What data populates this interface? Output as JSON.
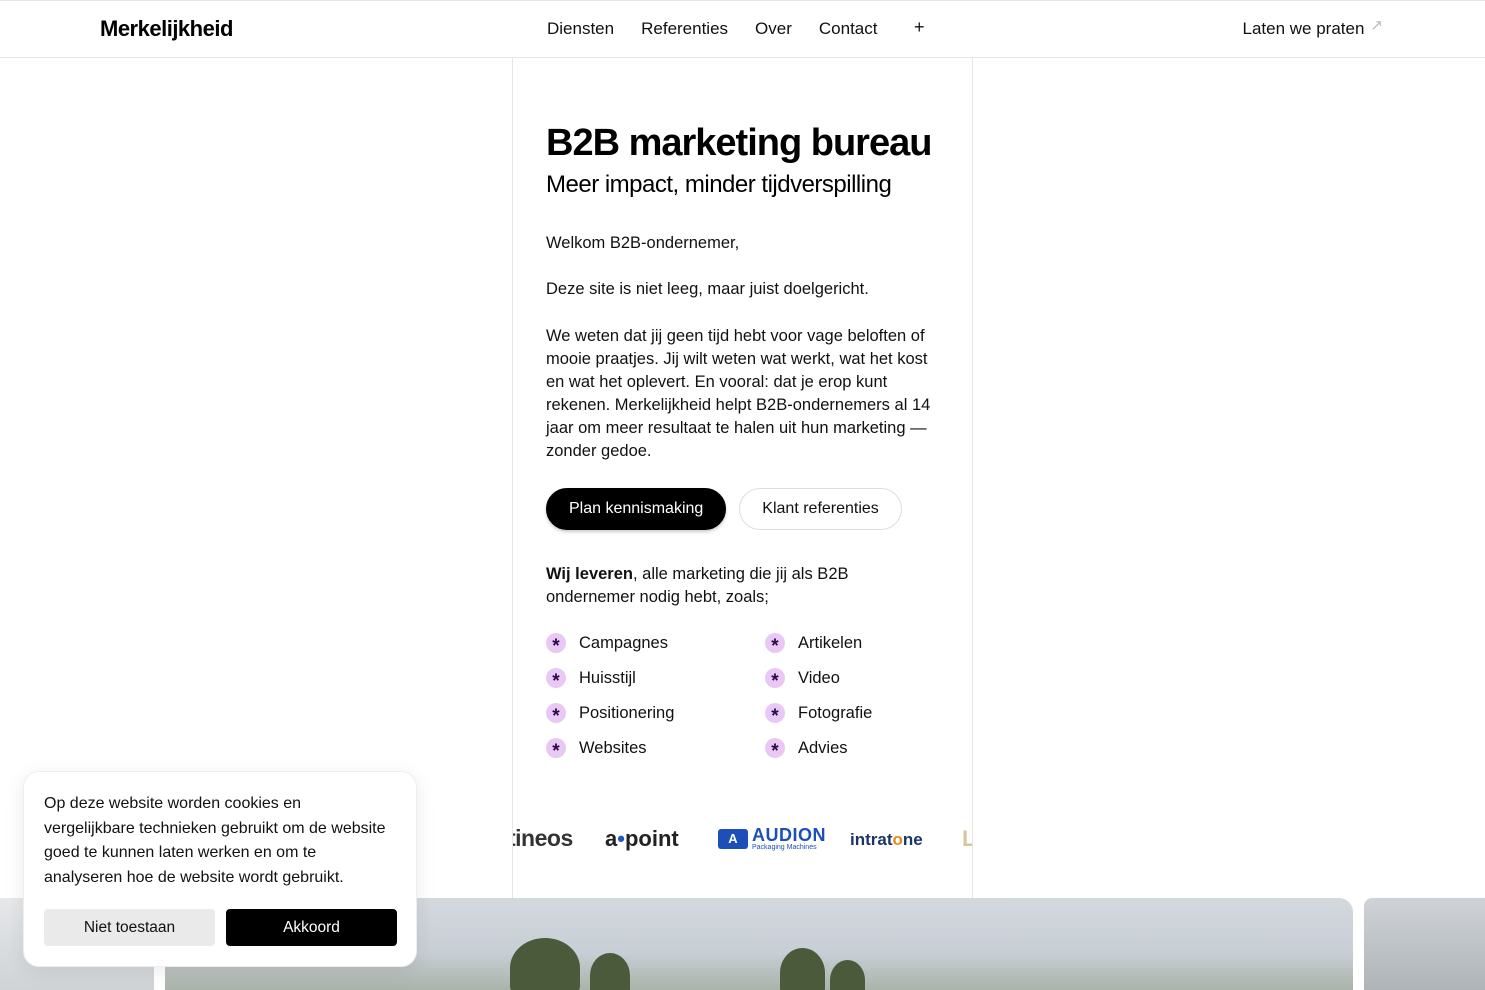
{
  "header": {
    "logo": "Merkelijkheid",
    "nav": [
      "Diensten",
      "Referenties",
      "Over",
      "Contact"
    ],
    "nav_more": "+",
    "cta": "Laten we praten",
    "cta_icon": "arrow-up-right-icon"
  },
  "hero": {
    "title": "B2B marketing bureau",
    "subtitle": "Meer impact, minder tijdverspilling",
    "greeting": "Welkom B2B-ondernemer,",
    "intro": "Deze site is niet leeg, maar juist doelgericht.",
    "body": "We weten dat jij geen tijd hebt voor vage beloften of mooie praatjes. Jij wilt weten wat werkt, wat het kost en wat het oplevert. En vooral: dat je erop kunt rekenen. Merkelijkheid helpt B2B-ondernemers al 14 jaar om meer resultaat te halen uit hun marketing — zonder gedoe.",
    "primary_button": "Plan kennismaking",
    "secondary_button": "Klant referenties",
    "lead_bold": "Wij leveren",
    "lead_rest": ", alle marketing die jij als B2B ondernemer nodig hebt, zoals;",
    "services": [
      "Campagnes",
      "Artikelen",
      "Huisstijl",
      "Video",
      "Positionering",
      "Fotografie",
      "Websites",
      "Advies"
    ],
    "service_icon": "asterisk-icon",
    "service_icon_color": "#e9c8f5"
  },
  "logos": {
    "tineos": "tineos",
    "apoint_a": "a",
    "apoint_b": "point",
    "audion_mark": "A",
    "audion_name": "AUDION",
    "audion_sub": "Packaging Machines",
    "intra_a": "intrat",
    "intra_o": "o",
    "intra_b": "ne",
    "last": "L"
  },
  "cookie": {
    "text": "Op deze website worden cookies en vergelijkbare technieken gebruikt om de website goed te kunnen laten werken en om te analyseren hoe de website wordt gebruikt.",
    "deny": "Niet toestaan",
    "accept": "Akkoord"
  }
}
